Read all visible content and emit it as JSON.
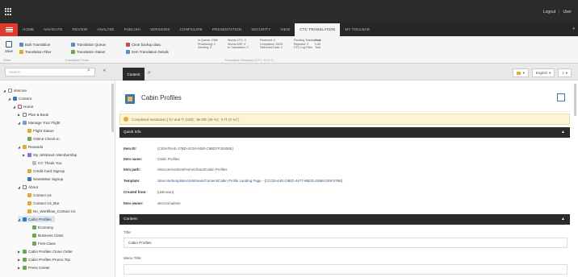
{
  "topbar": {
    "logout": "Logout",
    "separator": "|",
    "user": "User"
  },
  "ribbon_tabs": [
    {
      "label": "HOME"
    },
    {
      "label": "NAVIGATE"
    },
    {
      "label": "REVIEW"
    },
    {
      "label": "ANALYZE"
    },
    {
      "label": "PUBLISH"
    },
    {
      "label": "VERSIONS"
    },
    {
      "label": "CONFIGURE"
    },
    {
      "label": "PRESENTATION"
    },
    {
      "label": "SECURITY"
    },
    {
      "label": "VIEW"
    },
    {
      "label": "CTC TRANSLATION"
    },
    {
      "label": "MY TOOLBAR"
    }
  ],
  "ribbon": {
    "save_label": "Save",
    "write_caption": "Write",
    "bulk_translation": "Bulk Translation",
    "translation_filter": "Translation Filter",
    "translation queue": "Translation Queue",
    "translation_status": "Translation Status",
    "translation_tools_caption": "Translation Tools",
    "clear_backup": "Clear backup data",
    "item_translation_details": "Item Translation Details",
    "status_block_1": [
      "In Queue: 2386",
      "Processing: 0",
      "Sending: 0"
    ],
    "status_block_2": [
      "Words CTC: 0",
      "Words ASP: 0",
      "In Translation: 0"
    ],
    "status_block_3": [
      "Received: 0",
      "Completed: 25/25",
      "Delivered Data: 0"
    ],
    "status_block_4": [
      "Pending Translations",
      "Rejected: 0",
      "CTC Log Files"
    ],
    "status_block_5": [
      "Cost",
      "0.00",
      "Trial"
    ],
    "status_caption": "Translation Statuses (CTC 10.5.7)"
  },
  "search": {
    "placeholder": "Search"
  },
  "content_tab": "Content",
  "right_tools": {
    "language": "English"
  },
  "tree": [
    {
      "label": "sitecore"
    },
    {
      "label": "Content"
    },
    {
      "label": "Home"
    },
    {
      "label": "Plan & Book"
    },
    {
      "label": "Manage Your Flight"
    },
    {
      "label": "Flight Status"
    },
    {
      "label": "Online Check-in"
    },
    {
      "label": "Rewards"
    },
    {
      "label": "My Jetstream Membership"
    },
    {
      "label": "CC Thank You"
    },
    {
      "label": "Credit Card Signup"
    },
    {
      "label": "Newsletter Signup"
    },
    {
      "label": "About"
    },
    {
      "label": "Contact Us"
    },
    {
      "label": "Contact Us_Bar"
    },
    {
      "label": "No_Workflow_Contact Us"
    },
    {
      "label": "Cabin Profiles"
    },
    {
      "label": "Economy"
    },
    {
      "label": "Business Class"
    },
    {
      "label": "First Class"
    },
    {
      "label": "Cabin Profiles Clone Order"
    },
    {
      "label": "Cabin Profiles Promo Top"
    },
    {
      "label": "Press Center"
    }
  ],
  "item": {
    "title": "Cabin Profiles",
    "warning": "Completed translation [ 'fo' and 'fr (100)', 'de-DE (46 %)', 'it-IT (0 %)'] ."
  },
  "quick_info": {
    "header": "Quick Info",
    "rows": [
      {
        "key": "Item ID:",
        "value": "{C63AF5AE-17BD-4C04-9490-C9BD7F30406E}"
      },
      {
        "key": "Item name:",
        "value": "Cabin Profiles"
      },
      {
        "key": "Item path:",
        "value": "/sitecore/content/Home/About/Cabin Profiles"
      },
      {
        "key": "Template:",
        "value": "/sitecore/templates/Jetstream/Content/Cabin Profile Landing Page - {CC03A44D-C8ED-4477-8BDD-2D5EC0DF27B0}"
      },
      {
        "key": "Created from:",
        "value": "[unknown]"
      },
      {
        "key": "Item owner:",
        "value": "sitecore\\admin"
      }
    ]
  },
  "content_section": {
    "header": "Content",
    "title_label": "Title:",
    "title_value": "Cabin Profiles",
    "menu_title_label": "Menu Title:"
  },
  "colors": {
    "accent": "#e03a2c",
    "dark": "#2b2b2b",
    "warning_bg": "#fcf4d6"
  }
}
